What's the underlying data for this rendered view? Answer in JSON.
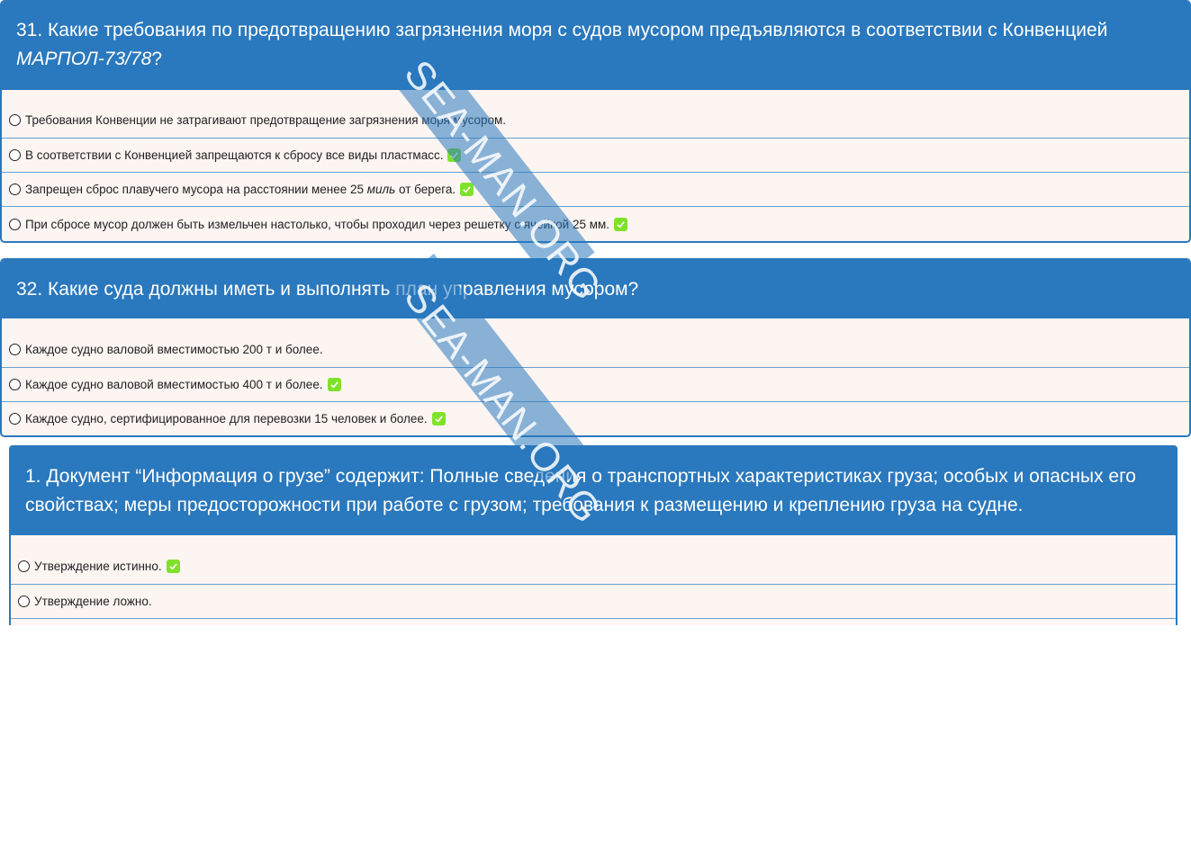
{
  "q31": {
    "title_a": "31. Какие требования по предотвращению загрязнения моря с судов мусором предъявляются в соответствии с Конвенцией",
    "title_b": "МАРПОЛ-73/78",
    "title_c": "?",
    "options": [
      {
        "text": "Требования Конвенции не затрагивают предотвращение загрязнения моря мусором.",
        "correct": false
      },
      {
        "text": "В соответствии с Конвенцией запрещаются к сбросу все виды пластмасс.",
        "correct": true
      },
      {
        "text_a": "Запрещен сброс плавучего мусора на расстоянии менее 25 ",
        "text_i": "миль",
        "text_b": " от берега.",
        "correct": true
      },
      {
        "text": "При сбросе мусор должен быть измельчен настолько, чтобы проходил через решетку с ячейкой 25 мм.",
        "correct": true
      }
    ]
  },
  "q32": {
    "title": "32. Какие суда должны иметь и выполнять план управления мусором?",
    "options": [
      {
        "text": "Каждое судно валовой вместимостью 200 т и более.",
        "correct": false
      },
      {
        "text": "Каждое судно валовой вместимостью 400 т и более.",
        "correct": true
      },
      {
        "text": "Каждое судно, сертифицированное для перевозки 15 человек и более.",
        "correct": true
      }
    ]
  },
  "q1": {
    "title": "1. Документ “Информация о грузе” содержит: Полные сведения о транспортных характеристиках груза; особых и опасных его свойствах; меры предосторожности при работе с грузом; требования к размещению и креплению груза на судне.",
    "options": [
      {
        "text": "Утверждение истинно.",
        "correct": true
      },
      {
        "text": "Утверждение ложно.",
        "correct": false
      }
    ]
  },
  "watermark": "SEA-MAN.ORG",
  "colors": {
    "header": "#2a78bd",
    "body": "#fcf5f2",
    "check": "#7fe22a"
  }
}
